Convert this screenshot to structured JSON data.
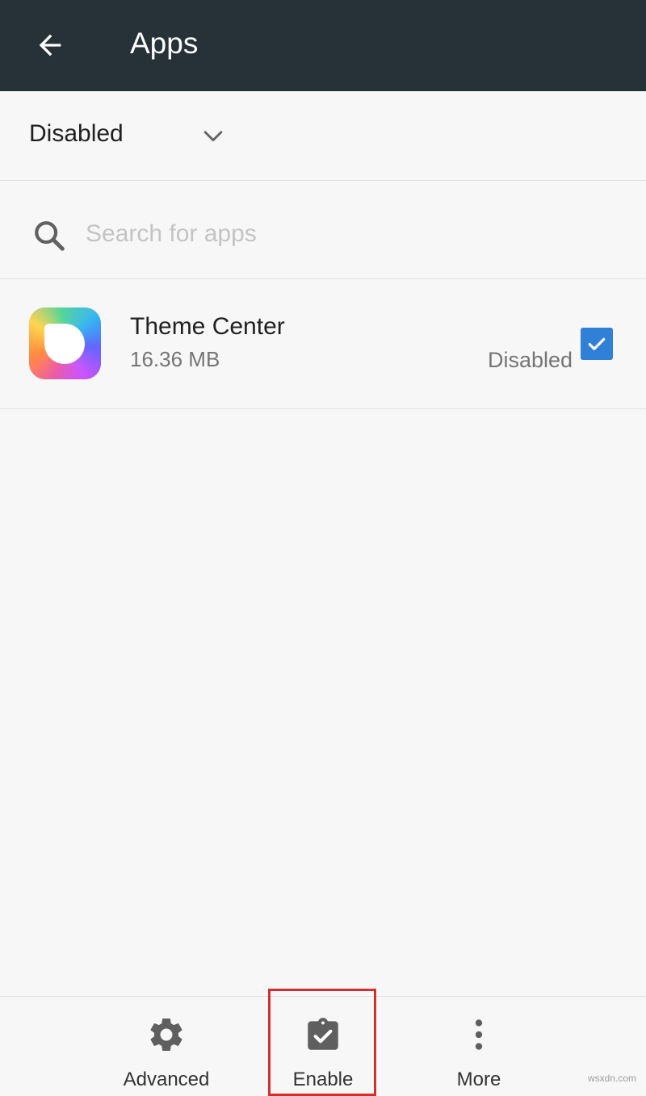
{
  "header": {
    "title": "Apps",
    "back_icon": "arrow-back-icon"
  },
  "filter": {
    "selected": "Disabled",
    "icon": "chevron-down-icon"
  },
  "search": {
    "placeholder": "Search for apps",
    "value": "",
    "icon": "search-icon"
  },
  "apps": [
    {
      "name": "Theme Center",
      "size": "16.36 MB",
      "status": "Disabled",
      "checked": true,
      "icon": "theme-center-app-icon"
    }
  ],
  "bottom_actions": {
    "advanced": {
      "label": "Advanced",
      "icon": "gear-icon"
    },
    "enable": {
      "label": "Enable",
      "icon": "clipboard-check-icon",
      "highlighted": true
    },
    "more": {
      "label": "More",
      "icon": "more-vertical-icon"
    }
  },
  "watermark": "wsxdn.com",
  "colors": {
    "app_bar": "#263238",
    "checkbox": "#2f80d6",
    "highlight": "#d32f2f",
    "background": "#f7f7f7"
  }
}
